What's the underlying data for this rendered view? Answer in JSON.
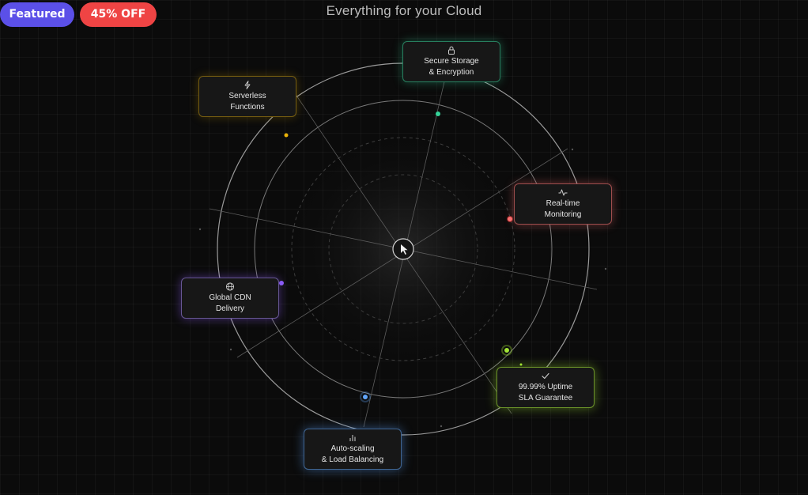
{
  "badges": {
    "featured": "Featured",
    "discount": "45% OFF"
  },
  "heading": "Everything for your Cloud",
  "features": [
    {
      "line1": "Secure Storage",
      "line2": "& Encryption",
      "icon": "lock-icon",
      "color": "#34d399"
    },
    {
      "line1": "Serverless",
      "line2": "Functions",
      "icon": "lightning-icon",
      "color": "#eab308"
    },
    {
      "line1": "Real-time",
      "line2": "Monitoring",
      "icon": "activity-icon",
      "color": "#f87171"
    },
    {
      "line1": "Global CDN",
      "line2": "Delivery",
      "icon": "globe-icon",
      "color": "#8b5cf6"
    },
    {
      "line1": "99.99% Uptime",
      "line2": "SLA Guarantee",
      "icon": "check-icon",
      "color": "#a3e635"
    },
    {
      "line1": "Auto-scaling",
      "line2": "& Load Balancing",
      "icon": "bar-chart-icon",
      "color": "#60a5fa"
    }
  ],
  "center_icon": "cursor-icon"
}
